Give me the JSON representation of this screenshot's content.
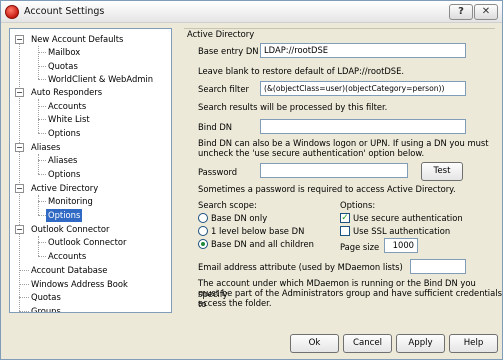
{
  "window": {
    "title": "Account Settings",
    "help_glyph": "?",
    "close_glyph": "✕"
  },
  "tree": {
    "items": [
      {
        "label": "New Account Defaults",
        "expander": "−"
      },
      {
        "label": "Mailbox"
      },
      {
        "label": "Quotas"
      },
      {
        "label": "WorldClient & WebAdmin"
      },
      {
        "label": "Auto Responders",
        "expander": "−"
      },
      {
        "label": "Accounts"
      },
      {
        "label": "White List"
      },
      {
        "label": "Options"
      },
      {
        "label": "Aliases",
        "expander": "−"
      },
      {
        "label": "Aliases"
      },
      {
        "label": "Options"
      },
      {
        "label": "Active Directory",
        "expander": "−"
      },
      {
        "label": "Monitoring"
      },
      {
        "label": "Options"
      },
      {
        "label": "Outlook Connector",
        "expander": "−"
      },
      {
        "label": "Outlook Connector"
      },
      {
        "label": "Accounts"
      },
      {
        "label": "Account Database"
      },
      {
        "label": "Windows Address Book"
      },
      {
        "label": "Quotas"
      },
      {
        "label": "Groups"
      }
    ],
    "selected_index": 13
  },
  "panel": {
    "group_title": "Active Directory",
    "base_entry_label": "Base entry DN",
    "base_entry_value": "LDAP://rootDSE",
    "base_entry_note": "Leave blank to restore default of LDAP://rootDSE.",
    "search_filter_label": "Search filter",
    "search_filter_value": "(&(objectClass=user)(objectCategory=person))",
    "search_filter_note": "Search results will be processed by this filter.",
    "bind_dn_label": "Bind DN",
    "bind_dn_value": "",
    "bind_dn_note_1": "Bind DN can also be a Windows logon or UPN.  If using a DN you must",
    "bind_dn_note_2": "uncheck the 'use secure authentication' option below.",
    "password_label": "Password",
    "password_value": "",
    "test_label": "Test",
    "password_note": "Sometimes a password is required to access Active Directory.",
    "scope_label": "Search scope:",
    "scope_options": [
      "Base DN only",
      "1 level below base DN",
      "Base DN and all children"
    ],
    "scope_selected": 2,
    "options_label": "Options:",
    "secure_auth_label": "Use secure authentication",
    "secure_auth_checked": true,
    "ssl_auth_label": "Use SSL authentication",
    "ssl_auth_checked": false,
    "page_size_label": "Page size",
    "page_size_value": "1000",
    "email_attr_label": "Email address attribute (used by MDaemon lists)",
    "email_attr_value": "",
    "footer_note_1": "The account under which MDaemon is running or the Bind DN you specify",
    "footer_note_2": "must be part of the Administrators group and have sufficient credentials to",
    "footer_note_3": "access the folder."
  },
  "buttons": {
    "ok": "Ok",
    "cancel": "Cancel",
    "apply": "Apply",
    "help": "Help"
  },
  "colors": {
    "selection": "#316ac5",
    "window_bg": "#ece9d8"
  }
}
